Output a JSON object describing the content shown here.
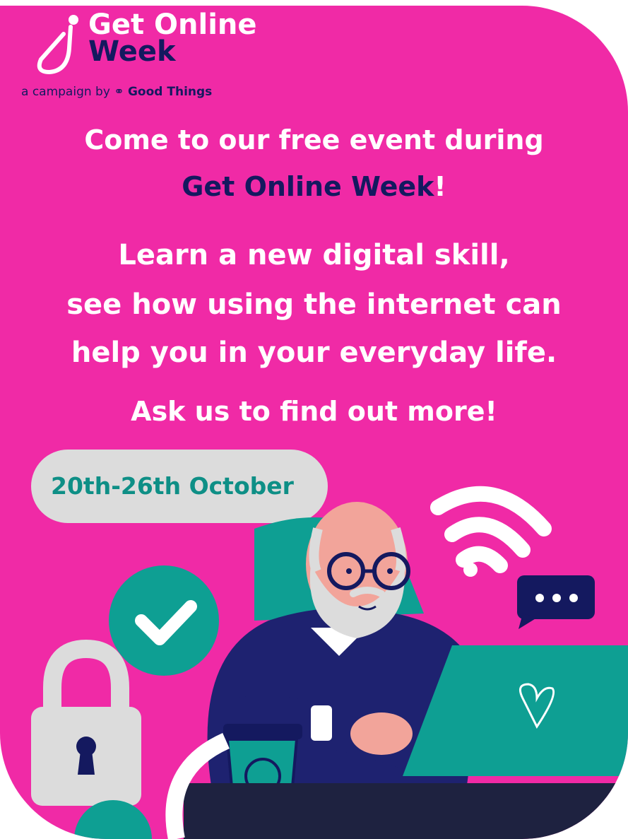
{
  "logo": {
    "line1": "Get Online",
    "line2": "Week",
    "campaign_prefix": "a campaign by",
    "campaign_brand": "Good Things"
  },
  "headline": {
    "line1": "Come to our free event during",
    "line2": "Get Online Week",
    "line2_suffix": "!"
  },
  "body": {
    "line1": "Learn a new digital skill,",
    "line2": "see how using the internet can",
    "line3": "help you in your everyday life."
  },
  "cta": "Ask us to find out more!",
  "date": "20th-26th October",
  "icons": [
    "wifi-icon",
    "chat-bubble-icon",
    "checkmark-icon",
    "padlock-icon",
    "heart-icon"
  ],
  "colors": {
    "background": "#F02AA6",
    "navy": "#14195F",
    "teal": "#0E9F93",
    "pill": "#DCDCDC"
  }
}
